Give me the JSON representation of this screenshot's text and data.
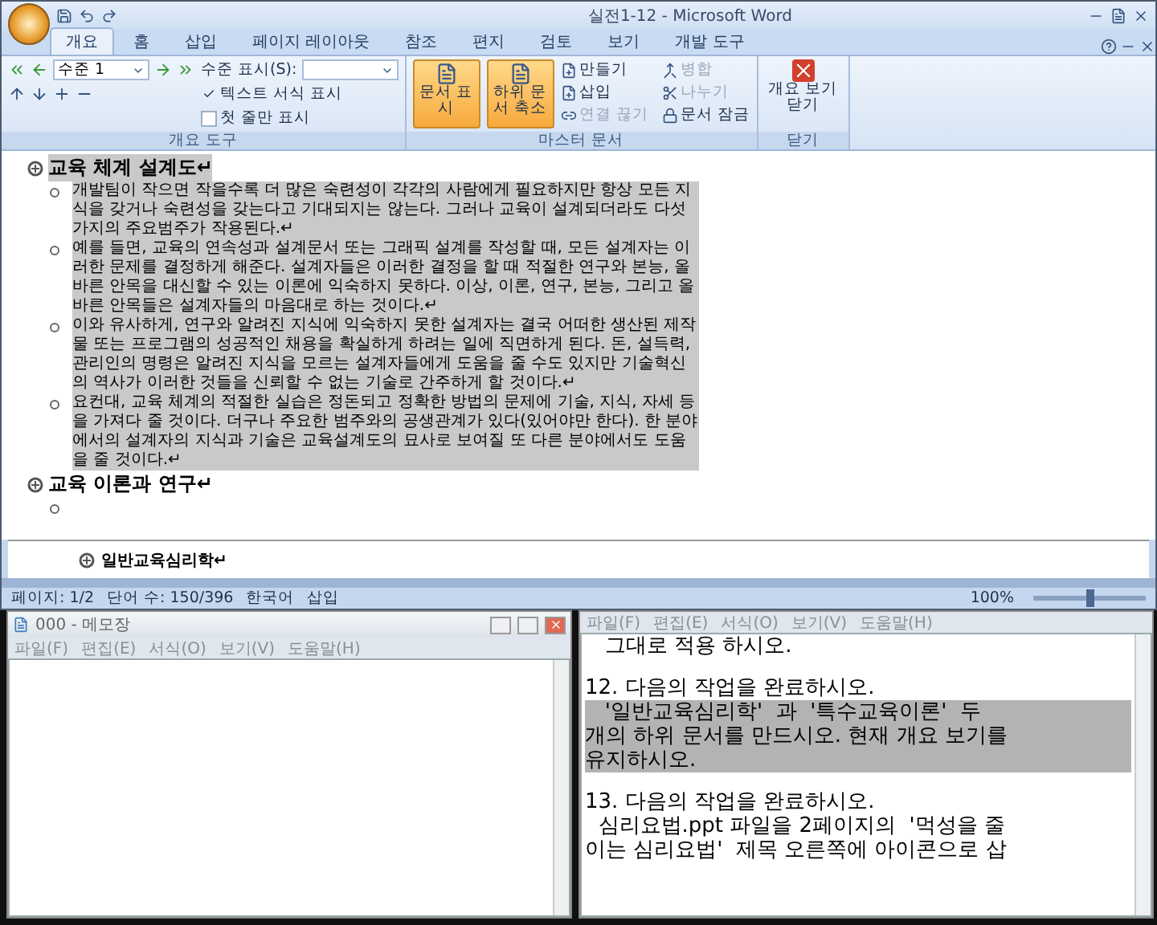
{
  "word": {
    "title": "실전1-12 - Microsoft Word",
    "tabs": [
      {
        "label": "개요",
        "selected": true
      },
      {
        "label": "홈",
        "selected": false
      },
      {
        "label": "삽입",
        "selected": false
      },
      {
        "label": "페이지 레이아웃",
        "selected": false
      },
      {
        "label": "참조",
        "selected": false
      },
      {
        "label": "편지",
        "selected": false
      },
      {
        "label": "검토",
        "selected": false
      },
      {
        "label": "보기",
        "selected": false
      },
      {
        "label": "개발 도구",
        "selected": false
      }
    ],
    "ribbon": {
      "outline_tools": {
        "label": "개요 도구",
        "level": "수준 1",
        "show_level_label": "수준 표시(S):",
        "options": [
          {
            "label": "텍스트 서식 표시",
            "checked": true
          },
          {
            "label": "첫 줄만 표시",
            "checked": false
          }
        ]
      },
      "master_document": {
        "label": "마스터 문서",
        "large_buttons": [
          {
            "label": "문서 표시",
            "selected": true
          },
          {
            "label": "하위 문서 축소",
            "selected": true
          }
        ],
        "small_buttons": [
          {
            "label": "만들기",
            "disabled": false
          },
          {
            "label": "삽입",
            "disabled": false
          },
          {
            "label": "연결 끊기",
            "disabled": true
          },
          {
            "label": "병합",
            "disabled": true
          },
          {
            "label": "나누기",
            "disabled": true
          },
          {
            "label": "문서 잠금",
            "disabled": false
          }
        ]
      },
      "close": {
        "label": "닫기",
        "button": "개요 보기 닫기"
      }
    },
    "document": {
      "sections": [
        {
          "heading": "교육 체계 설계도↵",
          "selected": true,
          "paragraphs": [
            {
              "text": "개발팀이 작으면 작을수록 더 많은 숙련성이 각각의 사람에게 필요하지만 항상 모든 지식을 갖거나 숙련성을 갖는다고 기대되지는 않는다. 그러나 교육이 설계되더라도 다섯 가지의 주요범주가 작용된다.↵",
              "selected": true
            },
            {
              "text": "예를 들면, 교육의 연속성과 설계문서 또는 그래픽 설계를 작성할 때, 모든 설계자는 이러한 문제를 결정하게 해준다. 설계자들은 이러한 결정을 할 때 적절한 연구와 본능, 올바른 안목을 대신할 수 있는 이론에 익숙하지 못하다. 이상, 이론, 연구, 본능, 그리고 올바른 안목들은 설계자들의 마음대로 하는 것이다.↵",
              "selected": true
            },
            {
              "text": "이와 유사하게, 연구와 알려진 지식에 익숙하지 못한 설계자는 결국 어떠한 생산된 제작물 또는 프로그램의 성공적인 채용을 확실하게 하려는 일에 직면하게 된다. 돈, 설득력, 관리인의 명령은 알려진 지식을 모르는 설계자들에게 도움을 줄 수도 있지만 기술혁신의 역사가 이러한 것들을 신뢰할 수 없는 기술로 간주하게 할 것이다.↵",
              "selected": true
            },
            {
              "text": "요컨대, 교육 체계의 적절한 실습은 정돈되고 정확한 방법의 문제에 기술, 지식, 자세 등을 가져다 줄 것이다. 더구나 주요한 범주와의 공생관계가 있다(있어야만 한다). 한 분야에서의 설계자의 지식과 기술은 교육설계도의 묘사로 보여질 또 다른 분야에서도 도움을 줄 것이다.↵",
              "selected": true
            }
          ]
        },
        {
          "heading": "교육 이론과 연구↵",
          "selected": false
        }
      ]
    },
    "subdocument": {
      "heading": "일반교육심리학↵"
    },
    "status_bar": {
      "page": "페이지: 1/2",
      "words": "단어 수: 150/396",
      "language": "한국어",
      "mode": "삽입",
      "zoom": {
        "reading": "100%",
        "level": 0.5
      }
    }
  },
  "notepad_left": {
    "title": "000 - 메모장",
    "menu": [
      "파일(F)",
      "편집(E)",
      "서식(O)",
      "보기(V)",
      "도움말(H)"
    ]
  },
  "notepad_right": {
    "menu": [
      "파일(F)",
      "편집(E)",
      "서식(O)",
      "보기(V)",
      "도움말(H)"
    ],
    "blocks": [
      {
        "lines": [
          {
            "text": "   그대로 적용 하시오.",
            "selected": false
          }
        ]
      },
      {
        "lines": [
          {
            "text": "12. 다음의 작업을 완료하시오.",
            "selected": false
          },
          {
            "text": "   '일반교육심리학'  과  '특수교육이론'  두",
            "selected": true
          },
          {
            "text": "개의 하위 문서를 만드시오. 현재 개요 보기를",
            "selected": true
          },
          {
            "text": "유지하시오.",
            "selected": true
          }
        ]
      },
      {
        "lines": [
          {
            "text": "13. 다음의 작업을 완료하시오.",
            "selected": false
          },
          {
            "text": "  심리요법.ppt 파일을 2페이지의  '먹성을 줄",
            "selected": false
          },
          {
            "text": "이는 심리요법'  제목 오른쪽에 아이콘으로 삽",
            "selected": false
          }
        ]
      }
    ]
  }
}
